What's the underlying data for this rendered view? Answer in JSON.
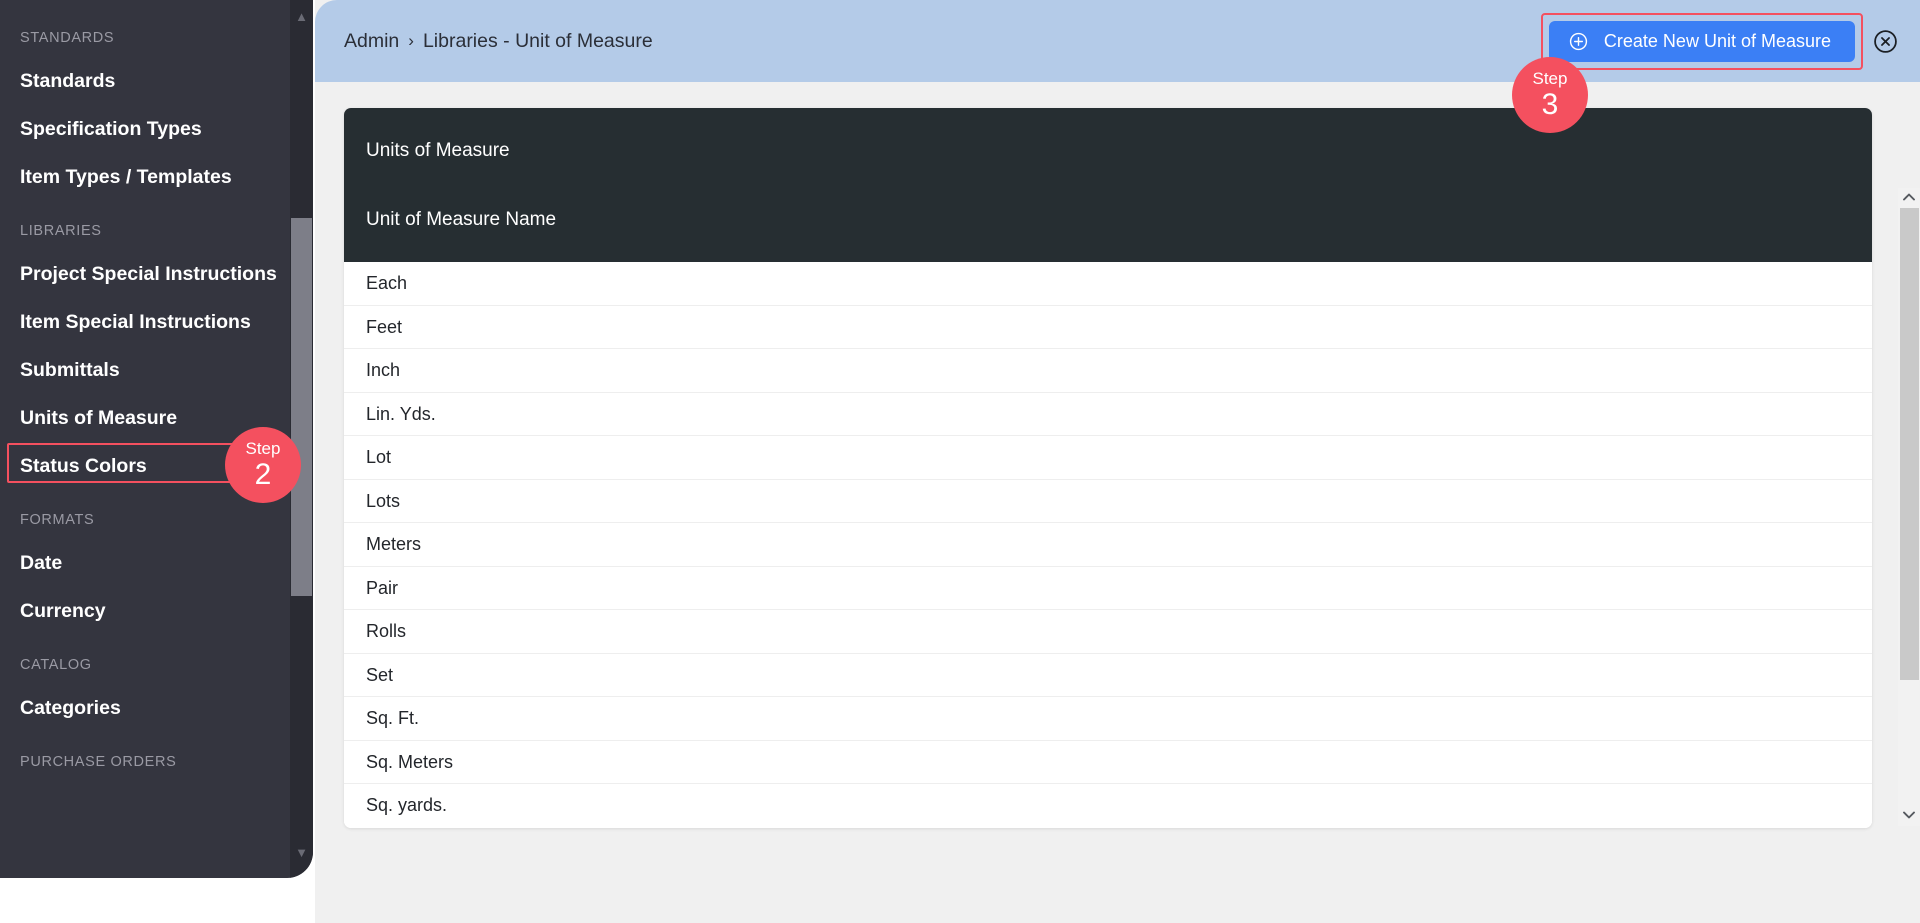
{
  "colors": {
    "sidebar_bg": "#34353f",
    "header_bg": "#b4cbe8",
    "accent_blue": "#3b7ff5",
    "highlight_red": "#f4505f",
    "card_head_bg": "#262e32",
    "page_bg": "#f0f0f0"
  },
  "sidebar": {
    "sections": [
      {
        "label": "STANDARDS",
        "items": [
          {
            "label": "Standards"
          },
          {
            "label": "Specification Types"
          },
          {
            "label": "Item Types / Templates"
          }
        ]
      },
      {
        "label": "LIBRARIES",
        "items": [
          {
            "label": "Project Special Instructions"
          },
          {
            "label": "Item Special Instructions"
          },
          {
            "label": "Submittals"
          },
          {
            "label": "Units of Measure"
          },
          {
            "label": "Status Colors"
          }
        ]
      },
      {
        "label": "FORMATS",
        "items": [
          {
            "label": "Date"
          },
          {
            "label": "Currency"
          }
        ]
      },
      {
        "label": "CATALOG",
        "items": [
          {
            "label": "Categories"
          }
        ]
      },
      {
        "label": "PURCHASE ORDERS",
        "items": []
      }
    ],
    "scroll_up_icon": "chevron-up-icon",
    "scroll_down_icon": "chevron-down-icon"
  },
  "header": {
    "breadcrumb": {
      "root": "Admin",
      "separator": "›",
      "current": "Libraries - Unit of Measure"
    },
    "create_button": {
      "label": "Create New Unit of Measure",
      "icon": "plus-circle-icon"
    },
    "close_icon": "close-circle-icon"
  },
  "card": {
    "title": "Units of Measure",
    "column_header": "Unit of Measure Name",
    "rows": [
      {
        "name": "Each"
      },
      {
        "name": "Feet"
      },
      {
        "name": "Inch"
      },
      {
        "name": "Lin. Yds."
      },
      {
        "name": "Lot"
      },
      {
        "name": "Lots"
      },
      {
        "name": "Meters"
      },
      {
        "name": "Pair"
      },
      {
        "name": "Rolls"
      },
      {
        "name": "Set"
      },
      {
        "name": "Sq. Ft."
      },
      {
        "name": "Sq. Meters"
      },
      {
        "name": "Sq. yards."
      }
    ],
    "scroll_up_icon": "chevron-up-icon",
    "scroll_down_icon": "chevron-down-icon"
  },
  "steps": [
    {
      "id": "step2",
      "label": "Step",
      "number": "2"
    },
    {
      "id": "step3",
      "label": "Step",
      "number": "3"
    }
  ]
}
